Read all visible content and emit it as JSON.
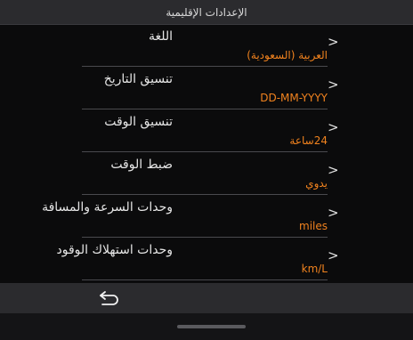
{
  "header": {
    "title": "الإعدادات الإقليمية"
  },
  "settings": [
    {
      "label": "اللغة",
      "value": "العربية (السعودية)",
      "dir": "rtl"
    },
    {
      "label": "تنسيق التاريخ",
      "value": "DD-MM-YYYY",
      "dir": "ltr"
    },
    {
      "label": "تنسيق الوقت",
      "value": "24ساعة",
      "dir": "rtl"
    },
    {
      "label": "ضبط الوقت",
      "value": "يدوي",
      "dir": "rtl"
    },
    {
      "label": "وحدات السرعة والمسافة",
      "value": "miles",
      "dir": "ltr"
    },
    {
      "label": "وحدات استهلاك الوقود",
      "value": "km/L",
      "dir": "ltr"
    }
  ],
  "chevron": ">",
  "colors": {
    "accent": "#f0821e",
    "background": "#0b0b0c",
    "bar": "#2b2b2e"
  },
  "icons": {
    "back": "back-arrow-icon"
  }
}
